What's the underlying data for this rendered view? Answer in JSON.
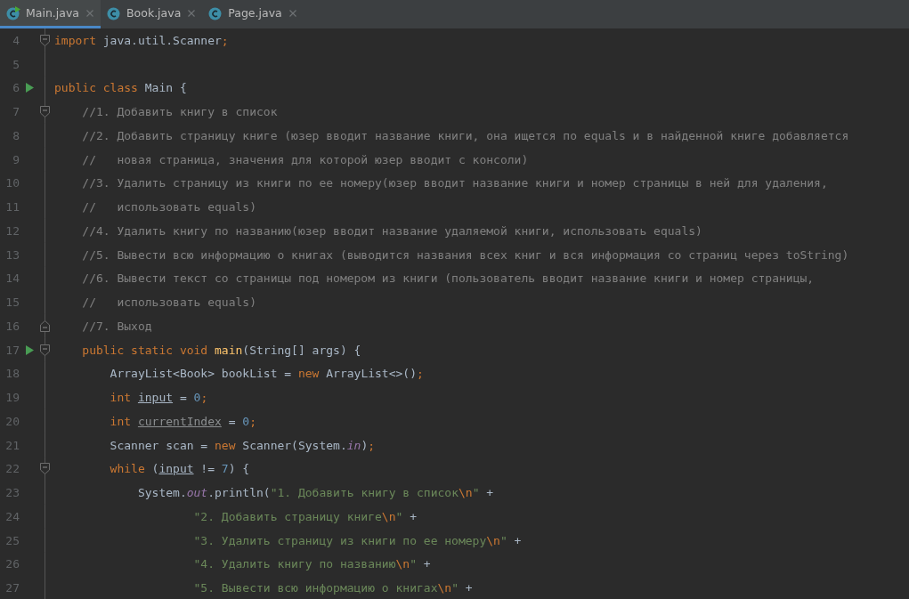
{
  "tabs": [
    {
      "label": "Main.java",
      "selected": true,
      "runnable": true
    },
    {
      "label": "Book.java",
      "selected": false,
      "runnable": false
    },
    {
      "label": "Page.java",
      "selected": false,
      "runnable": false
    }
  ],
  "editor": {
    "lines": [
      {
        "number": "4",
        "fold_start": true,
        "tokens": [
          {
            "kind": "kw",
            "text": "import"
          },
          {
            "kind": "plain",
            "text": " java.util.Scanner"
          },
          {
            "kind": "kw",
            "text": ";"
          }
        ]
      },
      {
        "number": "5"
      },
      {
        "number": "6",
        "run": true,
        "tokens": [
          {
            "kind": "kw",
            "text": "public class "
          },
          {
            "kind": "plain",
            "text": "Main {"
          }
        ]
      },
      {
        "number": "7",
        "fold_start": true,
        "tokens": [
          {
            "kind": "comment",
            "text": "    //1. Добавить книгу в список"
          }
        ]
      },
      {
        "number": "8",
        "tokens": [
          {
            "kind": "comment",
            "text": "    //2. Добавить страницу книге (юзер вводит название книги, она ищется по equals и в найденной книге добавляется"
          }
        ]
      },
      {
        "number": "9",
        "tokens": [
          {
            "kind": "comment",
            "text": "    //   новая страница, значения для которой юзер вводит с консоли)"
          }
        ]
      },
      {
        "number": "10",
        "tokens": [
          {
            "kind": "comment",
            "text": "    //3. Удалить страницу из книги по ее номеру(юзер вводит название книги и номер страницы в ней для удаления,"
          }
        ]
      },
      {
        "number": "11",
        "tokens": [
          {
            "kind": "comment",
            "text": "    //   использовать equals)"
          }
        ]
      },
      {
        "number": "12",
        "tokens": [
          {
            "kind": "comment",
            "text": "    //4. Удалить книгу по названию(юзер вводит название удаляемой книги, использовать equals)"
          }
        ]
      },
      {
        "number": "13",
        "tokens": [
          {
            "kind": "comment",
            "text": "    //5. Вывести всю информацию о книгах (выводится названия всех книг и вся информация со страниц через toString)"
          }
        ]
      },
      {
        "number": "14",
        "tokens": [
          {
            "kind": "comment",
            "text": "    //6. Вывести текст со страницы под номером из книги (пользователь вводит название книги и номер страницы,"
          }
        ]
      },
      {
        "number": "15",
        "tokens": [
          {
            "kind": "comment",
            "text": "    //   использовать equals)"
          }
        ]
      },
      {
        "number": "16",
        "fold_end": true,
        "tokens": [
          {
            "kind": "comment",
            "text": "    //7. Выход"
          }
        ]
      },
      {
        "number": "17",
        "run": true,
        "fold_start": true,
        "tokens": [
          {
            "kind": "kw",
            "text": "    public static void "
          },
          {
            "kind": "method",
            "text": "main"
          },
          {
            "kind": "plain",
            "text": "(String[] args) {"
          }
        ]
      },
      {
        "number": "18",
        "tokens": [
          {
            "kind": "plain",
            "text": "        ArrayList<Book> bookList = "
          },
          {
            "kind": "kw",
            "text": "new"
          },
          {
            "kind": "plain",
            "text": " ArrayList<>()"
          },
          {
            "kind": "kw",
            "text": ";"
          }
        ]
      },
      {
        "number": "19",
        "tokens": [
          {
            "kind": "kw",
            "text": "        int "
          },
          {
            "kind": "var",
            "text": "input"
          },
          {
            "kind": "plain",
            "text": " = "
          },
          {
            "kind": "number",
            "text": "0"
          },
          {
            "kind": "kw",
            "text": ";"
          }
        ]
      },
      {
        "number": "20",
        "tokens": [
          {
            "kind": "kw",
            "text": "        int "
          },
          {
            "kind": "unused",
            "text": "currentIndex"
          },
          {
            "kind": "plain",
            "text": " = "
          },
          {
            "kind": "number",
            "text": "0"
          },
          {
            "kind": "kw",
            "text": ";"
          }
        ]
      },
      {
        "number": "21",
        "tokens": [
          {
            "kind": "plain",
            "text": "        Scanner scan = "
          },
          {
            "kind": "kw",
            "text": "new"
          },
          {
            "kind": "plain",
            "text": " Scanner(System."
          },
          {
            "kind": "field",
            "text": "in"
          },
          {
            "kind": "plain",
            "text": ")"
          },
          {
            "kind": "kw",
            "text": ";"
          }
        ]
      },
      {
        "number": "22",
        "fold_start": true,
        "tokens": [
          {
            "kind": "kw",
            "text": "        while "
          },
          {
            "kind": "plain",
            "text": "("
          },
          {
            "kind": "var",
            "text": "input"
          },
          {
            "kind": "plain",
            "text": " != "
          },
          {
            "kind": "number",
            "text": "7"
          },
          {
            "kind": "plain",
            "text": ") {"
          }
        ]
      },
      {
        "number": "23",
        "tokens": [
          {
            "kind": "plain",
            "text": "            System."
          },
          {
            "kind": "field",
            "text": "out"
          },
          {
            "kind": "plain",
            "text": ".println("
          },
          {
            "kind": "string",
            "text": "\"1. Добавить книгу в список"
          },
          {
            "kind": "escape",
            "text": "\\n"
          },
          {
            "kind": "string",
            "text": "\""
          },
          {
            "kind": "plain",
            "text": " +"
          }
        ]
      },
      {
        "number": "24",
        "tokens": [
          {
            "kind": "string",
            "text": "                    \"2. Добавить страницу книге"
          },
          {
            "kind": "escape",
            "text": "\\n"
          },
          {
            "kind": "string",
            "text": "\""
          },
          {
            "kind": "plain",
            "text": " +"
          }
        ]
      },
      {
        "number": "25",
        "tokens": [
          {
            "kind": "string",
            "text": "                    \"3. Удалить страницу из книги по ее номеру"
          },
          {
            "kind": "escape",
            "text": "\\n"
          },
          {
            "kind": "string",
            "text": "\""
          },
          {
            "kind": "plain",
            "text": " +"
          }
        ]
      },
      {
        "number": "26",
        "tokens": [
          {
            "kind": "string",
            "text": "                    \"4. Удалить книгу по названию"
          },
          {
            "kind": "escape",
            "text": "\\n"
          },
          {
            "kind": "string",
            "text": "\""
          },
          {
            "kind": "plain",
            "text": " +"
          }
        ]
      },
      {
        "number": "27",
        "tokens": [
          {
            "kind": "string",
            "text": "                    \"5. Вывести всю информацию о книгах"
          },
          {
            "kind": "escape",
            "text": "\\n"
          },
          {
            "kind": "string",
            "text": "\""
          },
          {
            "kind": "plain",
            "text": " +"
          }
        ]
      }
    ]
  }
}
